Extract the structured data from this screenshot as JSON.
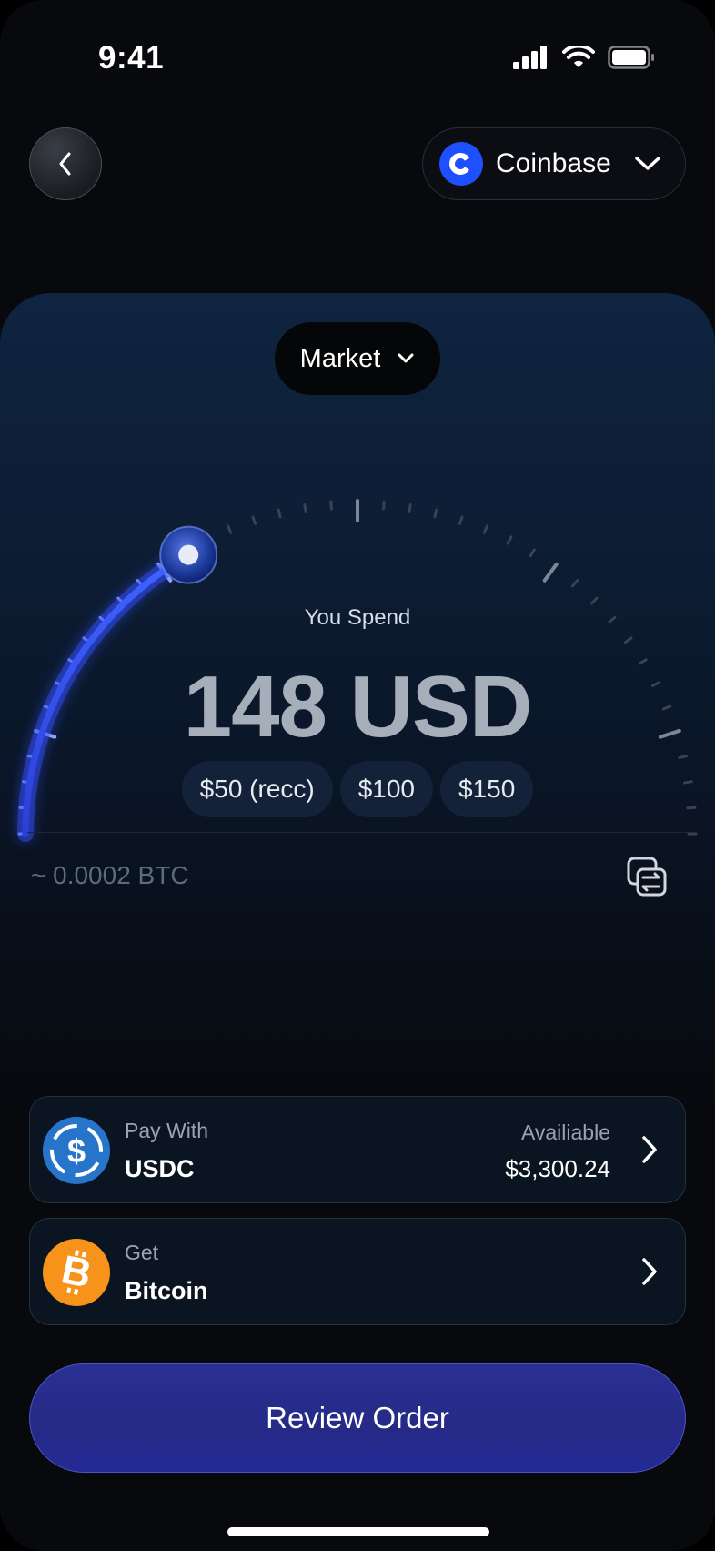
{
  "status_bar": {
    "time": "9:41",
    "icons": [
      "signal-icon",
      "wifi-icon",
      "battery-icon"
    ]
  },
  "header": {
    "back_icon": "chevron-left-icon",
    "exchange": {
      "name": "Coinbase",
      "logo_icon": "coinbase-logo-icon",
      "logo_color": "#1E50FF",
      "chevron_icon": "chevron-down-icon"
    }
  },
  "order": {
    "type_label": "Market",
    "spend_label": "You Spend",
    "amount": "148 USD",
    "slider_fraction": 0.33,
    "quick_amounts": [
      "$50 (recc)",
      "$100",
      "$150"
    ],
    "btc_estimate": "~ 0.0002 BTC",
    "swap_icon": "swap-icon",
    "accent_color": "#3A5CFF"
  },
  "pay_with": {
    "caption": "Pay With",
    "asset": "USDC",
    "icon": "usdc-icon",
    "icon_color": "#2775CA",
    "available_label": "Availiable",
    "available_value": "$3,300.24"
  },
  "get": {
    "caption": "Get",
    "asset": "Bitcoin",
    "icon": "bitcoin-icon",
    "icon_color": "#F7931A"
  },
  "cta": {
    "label": "Review Order"
  }
}
